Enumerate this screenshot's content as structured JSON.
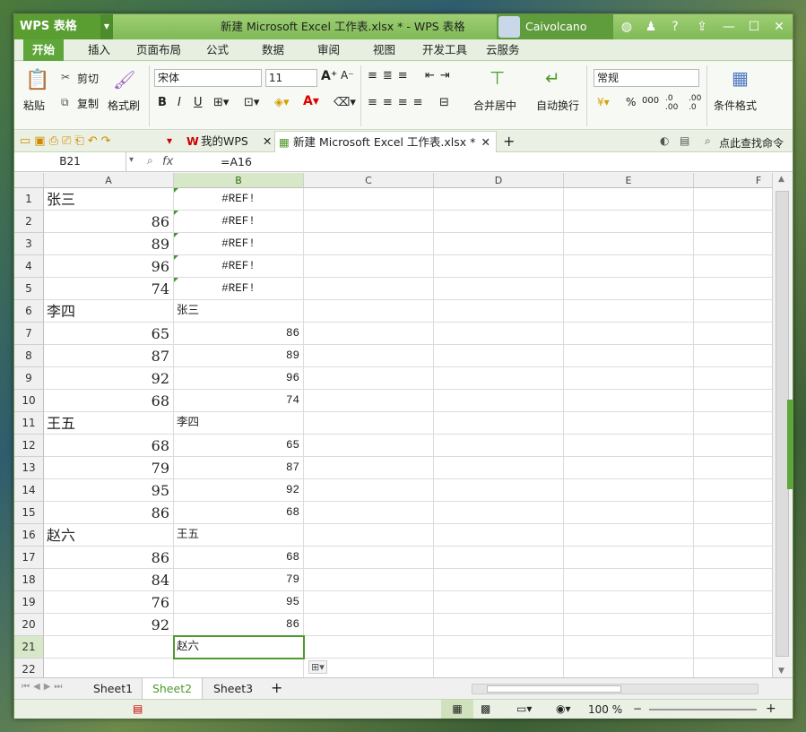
{
  "titlebar": {
    "app": "WPS 表格",
    "title": "新建 Microsoft Excel 工作表.xlsx * - WPS 表格",
    "user": "Caivolcano",
    "min": "—",
    "max": "☐",
    "close": "✕"
  },
  "tabs": [
    "开始",
    "插入",
    "页面布局",
    "公式",
    "数据",
    "审阅",
    "视图",
    "开发工具",
    "云服务"
  ],
  "ribbon": {
    "paste": "粘贴",
    "cut": "剪切",
    "copy": "复制",
    "format_painter": "格式刷",
    "font": "宋体",
    "size": "11",
    "merge": "合并居中",
    "wrap": "自动换行",
    "numfmt": "常规",
    "percent": "%",
    "cond": "条件格式"
  },
  "docbar": {
    "mywps": "我的WPS",
    "doc": "新建 Microsoft Excel 工作表.xlsx *",
    "search": "点此查找命令"
  },
  "formula": {
    "name": "B21",
    "fx": "fx",
    "value": "=A16"
  },
  "columns": [
    "A",
    "B",
    "C",
    "D",
    "E",
    "F"
  ],
  "rows": [
    [
      "张三",
      "#REF!"
    ],
    [
      "86",
      "#REF!"
    ],
    [
      "89",
      "#REF!"
    ],
    [
      "96",
      "#REF!"
    ],
    [
      "74",
      "#REF!"
    ],
    [
      "李四",
      "张三"
    ],
    [
      "65",
      "86"
    ],
    [
      "87",
      "89"
    ],
    [
      "92",
      "96"
    ],
    [
      "68",
      "74"
    ],
    [
      "王五",
      "李四"
    ],
    [
      "68",
      "65"
    ],
    [
      "79",
      "87"
    ],
    [
      "95",
      "92"
    ],
    [
      "86",
      "68"
    ],
    [
      "赵六",
      "王五"
    ],
    [
      "86",
      "68"
    ],
    [
      "84",
      "79"
    ],
    [
      "76",
      "95"
    ],
    [
      "92",
      "86"
    ],
    [
      "",
      "赵六"
    ],
    [
      "",
      ""
    ]
  ],
  "sheets": [
    "Sheet1",
    "Sheet2",
    "Sheet3"
  ],
  "active_sheet": "Sheet2",
  "status": {
    "zoom": "100 %"
  },
  "accent": "#5fa63a"
}
